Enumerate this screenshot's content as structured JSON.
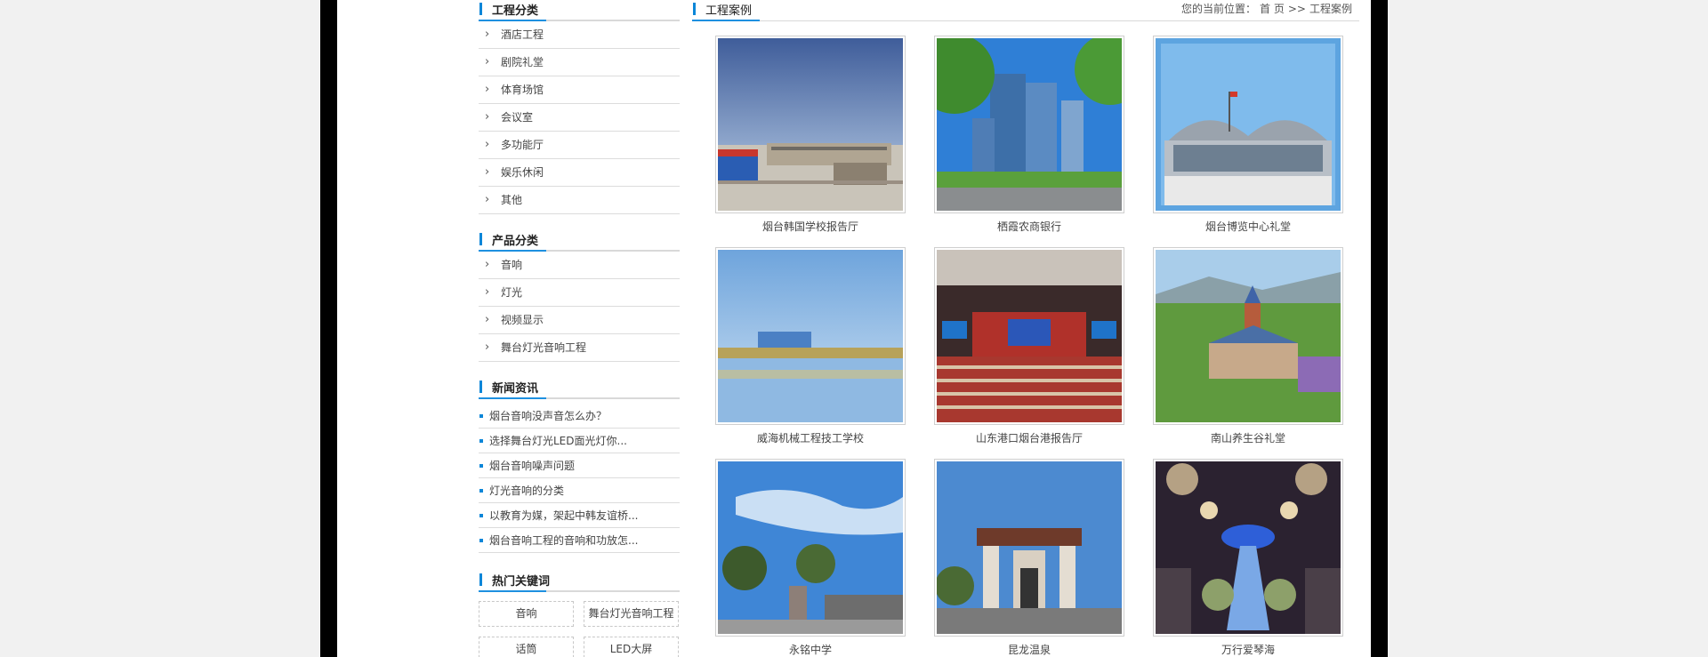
{
  "sidebar": {
    "engineering": {
      "title": "工程分类",
      "items": [
        "酒店工程",
        "剧院礼堂",
        "体育场馆",
        "会议室",
        "多功能厅",
        "娱乐休闲",
        "其他"
      ]
    },
    "products": {
      "title": "产品分类",
      "items": [
        "音响",
        "灯光",
        "视频显示",
        "舞台灯光音响工程"
      ]
    },
    "news": {
      "title": "新闻资讯",
      "items": [
        "烟台音响没声音怎么办？",
        "选择舞台灯光LED面光灯你...",
        "烟台音响噪声问题",
        "灯光音响的分类",
        "以教育为媒，架起中韩友谊桥...",
        "烟台音响工程的音响和功放怎..."
      ]
    },
    "keywords": {
      "title": "热门关键词",
      "items": [
        "音响",
        "舞台灯光音响工程",
        "话筒",
        "LED大屏"
      ]
    }
  },
  "main": {
    "title": "工程案例",
    "breadcrumb": {
      "prefix": "您的当前位置：",
      "home": "首 页",
      "sep": ">>",
      "current": "工程案例"
    },
    "cases": [
      {
        "caption": "烟台韩国学校报告厅",
        "scene": "school-gate"
      },
      {
        "caption": "栖霞农商银行",
        "scene": "bank-towers"
      },
      {
        "caption": "烟台博览中心礼堂",
        "scene": "expo-hall"
      },
      {
        "caption": "威海机械工程技工学校",
        "scene": "lake-campus"
      },
      {
        "caption": "山东港口烟台港报告厅",
        "scene": "auditorium"
      },
      {
        "caption": "南山养生谷礼堂",
        "scene": "church"
      },
      {
        "caption": "永铭中学",
        "scene": "sky-gate"
      },
      {
        "caption": "昆龙温泉",
        "scene": "arch-gate"
      },
      {
        "caption": "万行爱琴海",
        "scene": "banquet"
      }
    ]
  },
  "colors": {
    "accent": "#0b86d8",
    "frame": "#000000",
    "background": "#f1f1f1"
  }
}
